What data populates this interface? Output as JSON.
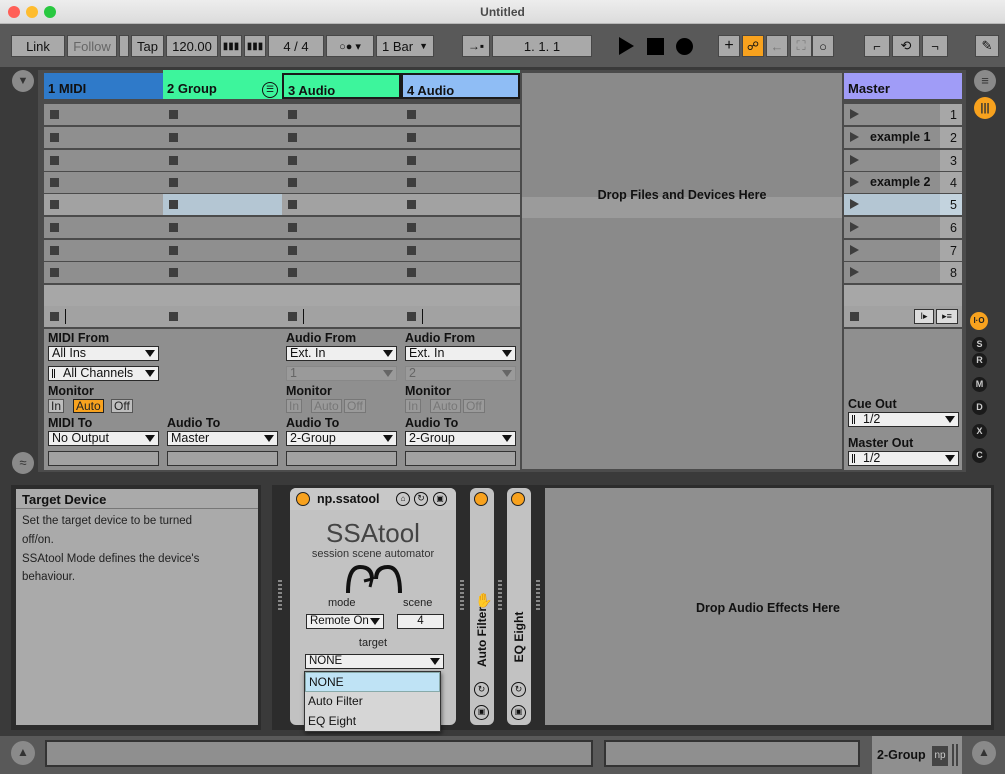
{
  "window": {
    "title": "Untitled"
  },
  "transport": {
    "link": "Link",
    "follow": "Follow",
    "tap": "Tap",
    "tempo": "120.00",
    "signature": "4 / 4",
    "quantize": "1 Bar",
    "position": "1.  1.  1"
  },
  "tracks": [
    {
      "name": "1 MIDI",
      "color": "#2f7ac9"
    },
    {
      "name": "2 Group",
      "color": "#3df59c"
    },
    {
      "name": "3 Audio",
      "color": "#3df59c"
    },
    {
      "name": "4 Audio",
      "color": "#8fbdf5"
    }
  ],
  "drop_files": "Drop Files and Devices Here",
  "io": {
    "midi_from": "MIDI From",
    "all_ins": "All Ins",
    "all_channels": "All Channels",
    "monitor": "Monitor",
    "in": "In",
    "auto": "Auto",
    "off": "Off",
    "midi_to": "MIDI To",
    "no_output": "No Output",
    "audio_to": "Audio To",
    "master": "Master",
    "audio_from": "Audio From",
    "ext_in": "Ext. In",
    "ch1": "1",
    "ch2": "2",
    "to_group": "2-Group"
  },
  "master": {
    "name": "Master",
    "color": "#a09cf7",
    "scenes": [
      {
        "name": "",
        "num": "1"
      },
      {
        "name": "example 1",
        "num": "2"
      },
      {
        "name": "",
        "num": "3"
      },
      {
        "name": "example 2",
        "num": "4"
      },
      {
        "name": "",
        "num": "5"
      },
      {
        "name": "",
        "num": "6"
      },
      {
        "name": "",
        "num": "7"
      },
      {
        "name": "",
        "num": "8"
      }
    ],
    "cue_out": "Cue Out",
    "cue_val": "1/2",
    "master_out": "Master Out",
    "master_val": "1/2"
  },
  "info": {
    "title": "Target Device",
    "l1": "Set the target device to be turned",
    "l2": "off/on.",
    "l3": "SSAtool Mode defines the device's",
    "l4": "behaviour."
  },
  "device": {
    "name": "np.ssatool",
    "big": "SSAtool",
    "subtitle": "session scene automator",
    "mode_label": "mode",
    "scene_label": "scene",
    "mode_value": "Remote On",
    "scene_value": "4",
    "target_label": "target",
    "target_value": "NONE",
    "options": [
      "NONE",
      "Auto Filter",
      "EQ Eight"
    ]
  },
  "auto_filter": "Auto Filter",
  "eq_eight": "EQ Eight",
  "drop_audio": "Drop Audio Effects Here",
  "status": {
    "track": "2-Group",
    "np": "np"
  }
}
